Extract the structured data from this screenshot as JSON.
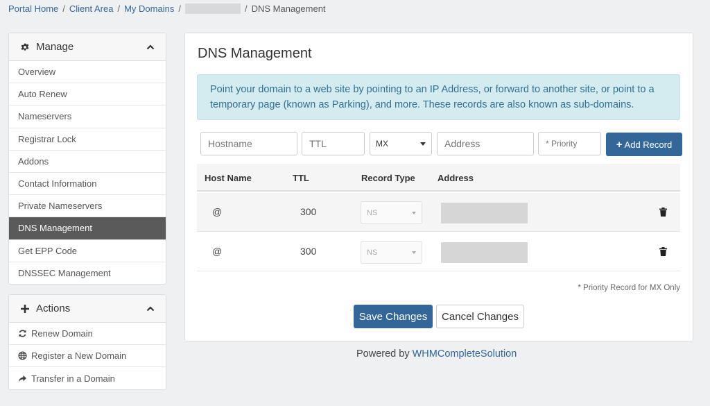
{
  "breadcrumb": {
    "items": [
      "Portal Home",
      "Client Area",
      "My Domains"
    ],
    "current": "DNS Management",
    "separator": "/"
  },
  "sidebar": {
    "manage": {
      "title": "Manage",
      "items": [
        "Overview",
        "Auto Renew",
        "Nameservers",
        "Registrar Lock",
        "Addons",
        "Contact Information",
        "Private Nameservers",
        "DNS Management",
        "Get EPP Code",
        "DNSSEC Management"
      ],
      "active": "DNS Management"
    },
    "actions": {
      "title": "Actions",
      "items": [
        {
          "label": "Renew Domain",
          "icon": "refresh-icon"
        },
        {
          "label": "Register a New Domain",
          "icon": "globe-icon"
        },
        {
          "label": "Transfer in a Domain",
          "icon": "share-arrow-icon"
        }
      ]
    }
  },
  "main": {
    "title": "DNS Management",
    "info": "Point your domain to a web site by pointing to an IP Address, or forward to another site, or point to a temporary page (known as Parking), and more. These records are also known as sub-domains.",
    "form": {
      "hostname_placeholder": "Hostname",
      "ttl_placeholder": "TTL",
      "type_value": "MX",
      "address_placeholder": "Address",
      "priority_placeholder": "* Priority",
      "add_label": "Add Record"
    },
    "table": {
      "headers": [
        "Host Name",
        "TTL",
        "Record Type",
        "Address"
      ],
      "rows": [
        {
          "host": "@",
          "ttl": "300",
          "type": "NS"
        },
        {
          "host": "@",
          "ttl": "300",
          "type": "NS"
        }
      ]
    },
    "note": "* Priority Record for MX Only",
    "save_label": "Save Changes",
    "cancel_label": "Cancel Changes"
  },
  "footer": {
    "prefix": "Powered by",
    "link": "WHMCompleteSolution"
  },
  "colors": {
    "primary": "#336699",
    "info_bg": "#d4ebf0",
    "active_item": "#5a5a5a"
  }
}
